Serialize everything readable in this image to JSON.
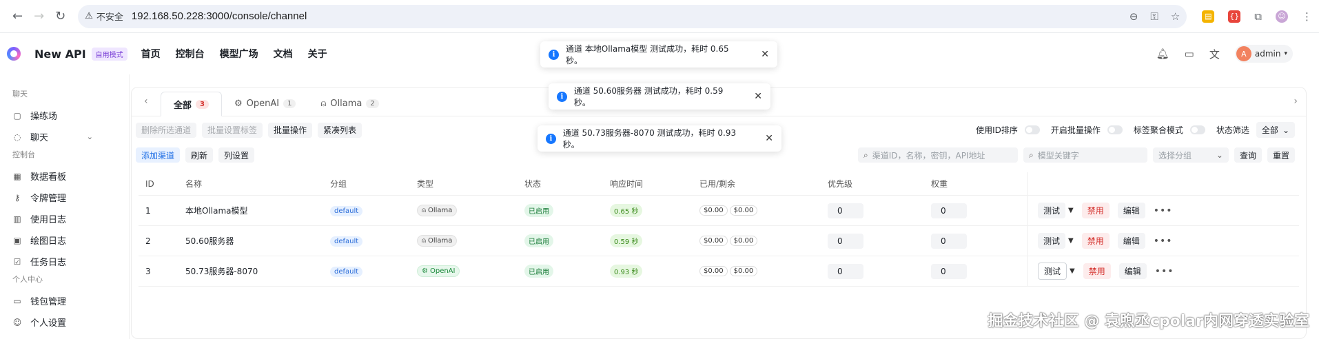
{
  "browser": {
    "insecure_label": "不安全",
    "url": "192.168.50.228:3000/console/channel"
  },
  "app": {
    "brand": "New API",
    "mode_badge": "自用模式",
    "nav": [
      "首页",
      "控制台",
      "模型广场",
      "文档",
      "关于"
    ],
    "user": "admin",
    "avatar_letter": "A"
  },
  "sidebar": {
    "groups": [
      {
        "title": "聊天",
        "items": [
          {
            "label": "操练场",
            "icon": "message-icon"
          },
          {
            "label": "聊天",
            "icon": "chat-icon",
            "chevron": true
          }
        ]
      },
      {
        "title": "控制台",
        "items": [
          {
            "label": "数据看板",
            "icon": "dashboard-icon"
          },
          {
            "label": "令牌管理",
            "icon": "key-icon"
          },
          {
            "label": "使用日志",
            "icon": "chart-icon"
          },
          {
            "label": "绘图日志",
            "icon": "image-icon"
          },
          {
            "label": "任务日志",
            "icon": "task-icon"
          }
        ]
      },
      {
        "title": "个人中心",
        "items": [
          {
            "label": "钱包管理",
            "icon": "wallet-icon"
          },
          {
            "label": "个人设置",
            "icon": "user-icon"
          }
        ]
      }
    ]
  },
  "tabs": [
    {
      "label": "全部",
      "count": "3",
      "active": true
    },
    {
      "label": "OpenAI",
      "count": "1"
    },
    {
      "label": "Ollama",
      "count": "2"
    }
  ],
  "toolbar": {
    "delete_disabled": "删除所选通道",
    "batch_tag": "批量设置标签",
    "batch_op": "批量操作",
    "compact": "紧凑列表",
    "sort_by_id": "使用ID排序",
    "enable_batch": "开启批量操作",
    "tag_mode": "标签聚合模式",
    "status_filter": "状态筛选",
    "status_value": "全部",
    "add": "添加渠道",
    "refresh": "刷新",
    "columns": "列设置",
    "search_placeholder": "渠道ID，名称，密钥，API地址",
    "model_placeholder": "模型关键字",
    "group_placeholder": "选择分组",
    "query": "查询",
    "reset": "重置"
  },
  "table": {
    "headers": [
      "ID",
      "名称",
      "分组",
      "类型",
      "状态",
      "响应时间",
      "已用/剩余",
      "优先级",
      "权重"
    ],
    "rows": [
      {
        "id": "1",
        "name": "本地Ollama模型",
        "group": "default",
        "type": "Ollama",
        "status": "已启用",
        "resp": "0.65 秒",
        "used": "$0.00",
        "remain": "$0.00",
        "priority": "0",
        "weight": "0"
      },
      {
        "id": "2",
        "name": "50.60服务器",
        "group": "default",
        "type": "Ollama",
        "status": "已启用",
        "resp": "0.59 秒",
        "used": "$0.00",
        "remain": "$0.00",
        "priority": "0",
        "weight": "0"
      },
      {
        "id": "3",
        "name": "50.73服务器-8070",
        "group": "default",
        "type": "OpenAI",
        "status": "已启用",
        "resp": "0.93 秒",
        "used": "$0.00",
        "remain": "$0.00",
        "priority": "0",
        "weight": "0"
      }
    ],
    "ops": {
      "test": "测试",
      "disable": "禁用",
      "edit": "编辑"
    }
  },
  "toasts": [
    "通道 本地Ollama模型 测试成功，耗时 0.65 秒。",
    "通道 50.60服务器 测试成功，耗时 0.59 秒。",
    "通道 50.73服务器-8070 测试成功，耗时 0.93 秒。"
  ],
  "watermark": "掘金技术社区 @ 袁煦丞cpolar内网穿透实验室"
}
